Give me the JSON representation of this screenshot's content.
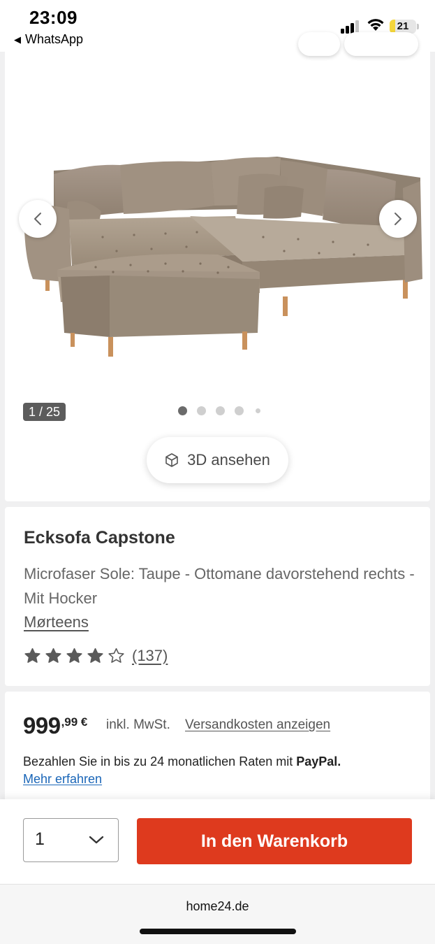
{
  "status_bar": {
    "time": "23:09",
    "back_app": "WhatsApp",
    "back_icon": "triangle-left-icon",
    "battery": "21",
    "battery_level": 0.21,
    "battery_color": "#f5d63b",
    "signal_bars": 3,
    "signal_icon": "cellular-signal-icon",
    "wifi_icon": "wifi-icon"
  },
  "gallery": {
    "counter": "1 / 25",
    "current_index": 1,
    "total": 25,
    "dots": 5,
    "active_dot": 0,
    "prev_icon": "chevron-left-icon",
    "next_icon": "chevron-right-icon",
    "image_subject": "sofa-image",
    "view_3d_label": "3D ansehen",
    "view_3d_icon": "cube-icon"
  },
  "product": {
    "title": "Ecksofa Capstone",
    "variant": "Microfaser Sole: Taupe - Ottomane davorstehend rechts - Mit Hocker",
    "brand": "Mørteens",
    "rating": 4,
    "rating_max": 5,
    "review_count": "(137)",
    "star_icon": "star-icon"
  },
  "pricing": {
    "price_main": "999",
    "price_cents": ",99 €",
    "vat_note": "inkl. MwSt.",
    "shipping_link": "Versandkosten anzeigen",
    "paypal_text": "Bezahlen Sie in bis zu 24 monatlichen Raten mit ",
    "paypal_brand": "PayPal.",
    "more_link": "Mehr erfahren"
  },
  "purchase": {
    "quantity": "1",
    "quantity_icon": "chevron-down-icon",
    "add_to_cart": "In den Warenkorb",
    "button_color": "#de3a1e"
  },
  "browser": {
    "url": "home24.de"
  }
}
